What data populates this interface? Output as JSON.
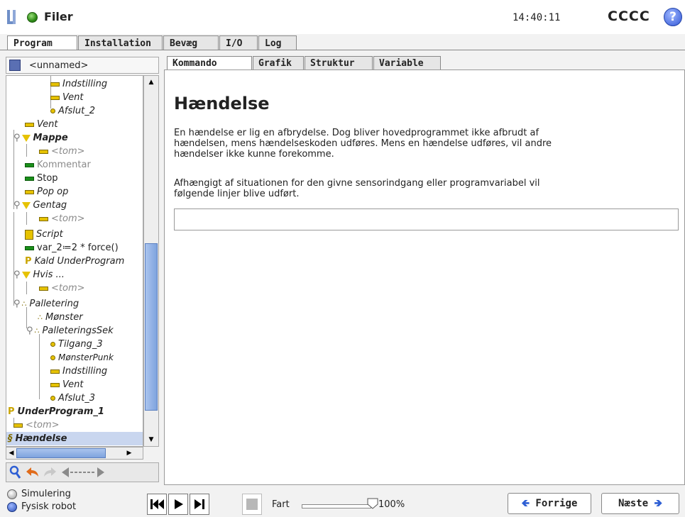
{
  "header": {
    "app_menu": "Filer",
    "clock": "14:40:11",
    "robot_name": "CCCC",
    "help": "?"
  },
  "main_tabs": [
    "Program",
    "Installation",
    "Bevæg",
    "I/O",
    "Log"
  ],
  "sub_tabs": [
    "Kommando",
    "Grafik",
    "Struktur",
    "Variable"
  ],
  "program_name": "<unnamed>",
  "tree": [
    {
      "label": "Indstilling",
      "icon": "wait-icon"
    },
    {
      "label": "Vent",
      "icon": "wait-icon"
    },
    {
      "label": "Afslut_2",
      "icon": "dot-icon"
    },
    {
      "label": "Vent",
      "icon": "wait-icon"
    },
    {
      "label": "Mappe",
      "icon": "folder-icon"
    },
    {
      "label": "<tom>",
      "icon": "wait-icon"
    },
    {
      "label": "Kommentar",
      "icon": "stop-icon"
    },
    {
      "label": "Stop",
      "icon": "stop-icon"
    },
    {
      "label": "Pop op",
      "icon": "wait-icon"
    },
    {
      "label": "Gentag",
      "icon": "folder-icon"
    },
    {
      "label": "<tom>",
      "icon": "wait-icon"
    },
    {
      "label": "Script",
      "icon": "script-icon"
    },
    {
      "label": "var_2≔2 * force()",
      "icon": "stop-icon"
    },
    {
      "label": "Kald UnderProgram",
      "icon": "subprogram-icon"
    },
    {
      "label": "Hvis ...",
      "icon": "folder-icon"
    },
    {
      "label": "<tom>",
      "icon": "wait-icon"
    },
    {
      "label": "Palletering",
      "icon": "pallet-icon"
    },
    {
      "label": "Mønster",
      "icon": "pallet-icon"
    },
    {
      "label": "PalleteringsSek",
      "icon": "pallet-icon"
    },
    {
      "label": "Tilgang_3",
      "icon": "dot-icon"
    },
    {
      "label": "MønsterPunk",
      "icon": "dot-icon"
    },
    {
      "label": "Indstilling",
      "icon": "wait-icon"
    },
    {
      "label": "Vent",
      "icon": "wait-icon"
    },
    {
      "label": "Afslut_3",
      "icon": "dot-icon"
    },
    {
      "label": "UnderProgram_1",
      "icon": "subprogram-icon"
    },
    {
      "label": "<tom>",
      "icon": "wait-icon"
    },
    {
      "label": "Hændelse",
      "icon": "event-icon"
    }
  ],
  "content": {
    "title": "Hændelse",
    "desc_line1": "En hændelse er lig en afbrydelse. Dog bliver hovedprogrammet ikke afbrudt af",
    "desc_line2": "hændelsen, mens hændelseskoden udføres. Mens en hændelse udføres, vil andre",
    "desc_line3": "hændelser ikke kunne forekomme.",
    "desc2_line1": "Afhængigt af situationen for den givne sensorindgang eller programvariabel vil",
    "desc2_line2": "følgende linjer blive udført.",
    "expression": ""
  },
  "bottom": {
    "sim_label": "Simulering",
    "real_label": "Fysisk robot",
    "speed_label": "Fart",
    "speed_value": "100%",
    "speed_fraction": 1.0,
    "prev_label": "Forrige",
    "next_label": "Næste"
  }
}
